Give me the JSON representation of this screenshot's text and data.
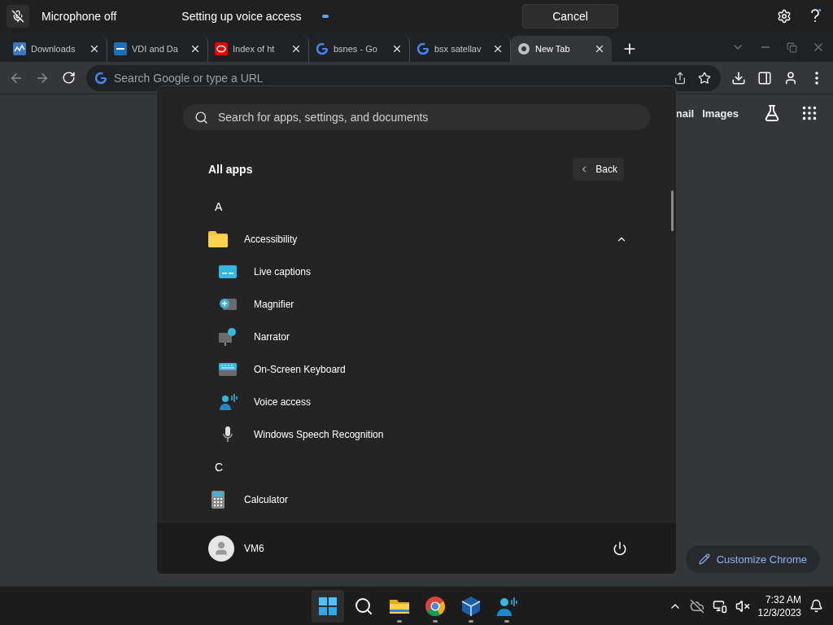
{
  "voice_access_bar": {
    "status": "Microphone off",
    "message": "Setting up voice access",
    "cancel_button": "Cancel"
  },
  "browser": {
    "tabs": [
      {
        "title": "Downloads",
        "selected": false
      },
      {
        "title": "VDI and Da",
        "selected": false
      },
      {
        "title": "Index of ht",
        "selected": false
      },
      {
        "title": "bsnes - Go",
        "selected": false
      },
      {
        "title": "bsx satellav",
        "selected": false
      },
      {
        "title": "New Tab",
        "selected": true
      }
    ],
    "omnibox": {
      "placeholder": "Search Google or type a URL"
    },
    "header_links": [
      "nail",
      "Images"
    ],
    "customize_button": "Customize Chrome"
  },
  "start_menu": {
    "search": {
      "placeholder": "Search for apps, settings, and documents"
    },
    "title": "All apps",
    "back_button": "Back",
    "items": [
      {
        "kind": "letter",
        "label": "A"
      },
      {
        "kind": "folder",
        "label": "Accessibility",
        "expanded": true,
        "children": [
          {
            "label": "Live captions"
          },
          {
            "label": "Magnifier"
          },
          {
            "label": "Narrator"
          },
          {
            "label": "On-Screen Keyboard"
          },
          {
            "label": "Voice access"
          },
          {
            "label": "Windows Speech Recognition"
          }
        ]
      },
      {
        "kind": "letter",
        "label": "C"
      },
      {
        "kind": "app",
        "label": "Calculator"
      }
    ],
    "user": "VM6"
  },
  "taskbar": {
    "items": [
      {
        "selected": true,
        "running": false
      },
      {
        "selected": false,
        "running": false
      },
      {
        "selected": false,
        "running": true
      },
      {
        "selected": false,
        "running": true
      },
      {
        "selected": false,
        "running": true
      },
      {
        "selected": false,
        "running": true
      }
    ],
    "time": "7:32 AM",
    "date": "12/3/2023"
  }
}
